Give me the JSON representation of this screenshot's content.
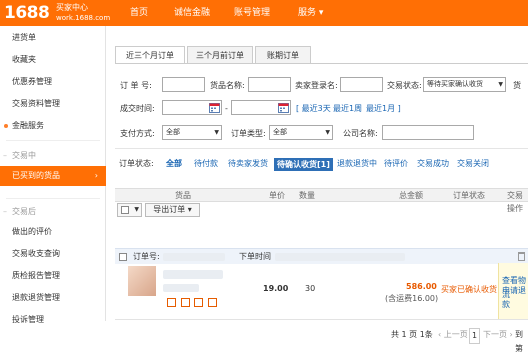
{
  "header": {
    "logo_text": "1688",
    "logo_sub1": "买家中心",
    "logo_sub2": "work.1688.com",
    "nav": [
      "首页",
      "诚信金融",
      "账号管理",
      "服务 ▾"
    ]
  },
  "sidebar": {
    "items": [
      {
        "label": "进货单"
      },
      {
        "label": "收藏夹"
      },
      {
        "label": "优惠券管理"
      },
      {
        "label": "交易资料管理"
      },
      {
        "label": "金融服务"
      },
      {
        "label": "交易中"
      },
      {
        "label": "已买到的货品"
      },
      {
        "label": "交易后"
      },
      {
        "label": "做出的评价"
      },
      {
        "label": "交易收支查询"
      },
      {
        "label": "质检报告管理"
      },
      {
        "label": "退款退货管理"
      },
      {
        "label": "投诉管理"
      }
    ]
  },
  "tabs": [
    "近三个月订单",
    "三个月前订单",
    "账期订单"
  ],
  "filters": {
    "order_no_label": "订 单 号:",
    "goods_name_label": "货品名称:",
    "seller_label": "卖家登录名:",
    "trade_status_label": "交易状态:",
    "trade_status_value": "等待买家确认收货",
    "deal_time_label": "成交时间:",
    "range_sep": "-",
    "quick_links": [
      "[ 最近3天",
      "最近1周",
      "最近1月 ]"
    ],
    "pay_method_label": "支付方式:",
    "pay_method_value": "全部",
    "order_type_label": "订单类型:",
    "order_type_value": "全部",
    "company_label": "公司名称:"
  },
  "status_tabs": {
    "label": "订单状态:",
    "items": [
      "全部",
      "待付款",
      "待卖家发货",
      "待确认收货[1]",
      "退款退货中",
      "待评价",
      "交易成功",
      "交易关闭"
    ]
  },
  "table": {
    "headers": [
      "货品",
      "单价",
      "数量",
      "总金额",
      "订单状态",
      "交易操作"
    ],
    "export_label": "导出订单 ▾",
    "order_no_label": "订单号:",
    "order_time_label": "下单时间"
  },
  "order": {
    "price": "19.00",
    "qty": "30",
    "total": "586.00",
    "shipping": "(含运费16.00)",
    "status": "买家已确认收货",
    "ops": [
      "查看物流",
      "申请退款"
    ]
  },
  "pager": {
    "text": "共 1 页 1条",
    "prev": "‹ 上一页",
    "page": "1",
    "next": "下一页 ›",
    "goto": "到第"
  },
  "colors": {
    "brand": "#ff6f05",
    "link": "#1a66b3",
    "active_pill": "#2e6fb6",
    "price": "#e85a00"
  }
}
